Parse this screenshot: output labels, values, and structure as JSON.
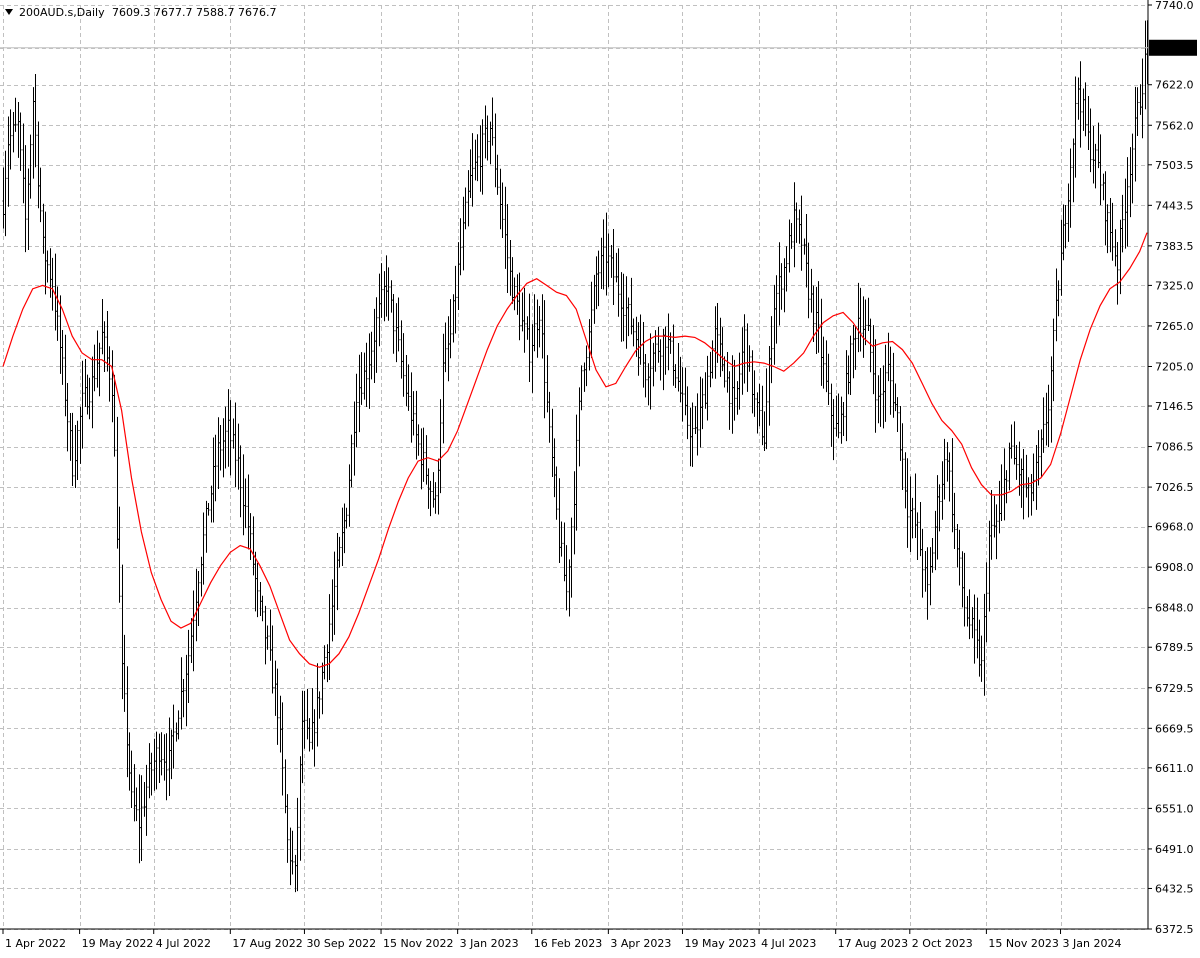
{
  "header": {
    "symbol": "200AUD.s,Daily",
    "ohlc": "7609.3 7677.7 7588.7 7676.7"
  },
  "colors": {
    "background": "#ffffff",
    "grid": "#c0c0c0",
    "bars": "#000000",
    "ma_line": "#ff0000",
    "price_badge_bg": "#000000",
    "price_badge_text": "#ffffff"
  },
  "chart_data": {
    "type": "ohlc-bar",
    "title": "200AUD.s,Daily",
    "grid": true,
    "ylim": [
      6372.5,
      7740.0
    ],
    "y_ticks": [
      "7740.0",
      "7676.7",
      "7622.0",
      "7562.0",
      "7503.5",
      "7443.5",
      "7383.5",
      "7325.0",
      "7265.0",
      "7205.0",
      "7146.5",
      "7086.5",
      "7026.5",
      "6968.0",
      "6908.0",
      "6848.0",
      "6789.5",
      "6729.5",
      "6669.5",
      "6611.0",
      "6551.0",
      "6491.0",
      "6432.5",
      "6372.5"
    ],
    "x_ticks": [
      "1 Apr 2022",
      "19 May 2022",
      "4 Jul 2022",
      "17 Aug 2022",
      "30 Sep 2022",
      "15 Nov 2022",
      "3 Jan 2023",
      "16 Feb 2023",
      "3 Apr 2023",
      "19 May 2023",
      "4 Jul 2023",
      "17 Aug 2023",
      "2 Oct 2023",
      "15 Nov 2023",
      "3 Jan 2024"
    ],
    "last_price": "7676.7",
    "close_path": [
      [
        0,
        7450
      ],
      [
        2,
        7540
      ],
      [
        6,
        7560
      ],
      [
        9,
        7420
      ],
      [
        12,
        7600
      ],
      [
        16,
        7380
      ],
      [
        20,
        7330
      ],
      [
        24,
        7200
      ],
      [
        28,
        7060
      ],
      [
        32,
        7150
      ],
      [
        36,
        7180
      ],
      [
        40,
        7250
      ],
      [
        44,
        7180
      ],
      [
        48,
        6750
      ],
      [
        52,
        6560
      ],
      [
        55,
        6530
      ],
      [
        59,
        6600
      ],
      [
        63,
        6640
      ],
      [
        67,
        6620
      ],
      [
        71,
        6700
      ],
      [
        75,
        6780
      ],
      [
        79,
        6900
      ],
      [
        83,
        7000
      ],
      [
        87,
        7080
      ],
      [
        91,
        7110
      ],
      [
        95,
        7060
      ],
      [
        99,
        6970
      ],
      [
        103,
        6860
      ],
      [
        107,
        6790
      ],
      [
        111,
        6700
      ],
      [
        115,
        6500
      ],
      [
        118,
        6450
      ],
      [
        121,
        6680
      ],
      [
        124,
        6640
      ],
      [
        127,
        6700
      ],
      [
        131,
        6800
      ],
      [
        135,
        6900
      ],
      [
        139,
        7000
      ],
      [
        143,
        7170
      ],
      [
        147,
        7200
      ],
      [
        151,
        7270
      ],
      [
        155,
        7330
      ],
      [
        159,
        7250
      ],
      [
        163,
        7170
      ],
      [
        167,
        7100
      ],
      [
        171,
        7050
      ],
      [
        175,
        7000
      ],
      [
        178,
        7200
      ],
      [
        181,
        7250
      ],
      [
        185,
        7380
      ],
      [
        189,
        7480
      ],
      [
        193,
        7520
      ],
      [
        197,
        7560
      ],
      [
        201,
        7450
      ],
      [
        205,
        7340
      ],
      [
        209,
        7280
      ],
      [
        213,
        7230
      ],
      [
        217,
        7290
      ],
      [
        221,
        7100
      ],
      [
        225,
        6950
      ],
      [
        228,
        6870
      ],
      [
        231,
        7020
      ],
      [
        234,
        7200
      ],
      [
        237,
        7250
      ],
      [
        240,
        7340
      ],
      [
        244,
        7370
      ],
      [
        248,
        7330
      ],
      [
        252,
        7290
      ],
      [
        256,
        7250
      ],
      [
        260,
        7200
      ],
      [
        264,
        7230
      ],
      [
        268,
        7250
      ],
      [
        272,
        7200
      ],
      [
        276,
        7130
      ],
      [
        280,
        7100
      ],
      [
        284,
        7170
      ],
      [
        288,
        7250
      ],
      [
        292,
        7200
      ],
      [
        296,
        7140
      ],
      [
        300,
        7250
      ],
      [
        304,
        7150
      ],
      [
        308,
        7100
      ],
      [
        312,
        7300
      ],
      [
        316,
        7350
      ],
      [
        320,
        7420
      ],
      [
        323,
        7390
      ],
      [
        326,
        7320
      ],
      [
        330,
        7250
      ],
      [
        334,
        7150
      ],
      [
        338,
        7100
      ],
      [
        342,
        7200
      ],
      [
        346,
        7280
      ],
      [
        350,
        7250
      ],
      [
        354,
        7150
      ],
      [
        358,
        7200
      ],
      [
        362,
        7130
      ],
      [
        366,
        7000
      ],
      [
        370,
        6960
      ],
      [
        374,
        6870
      ],
      [
        378,
        7000
      ],
      [
        382,
        7080
      ],
      [
        385,
        6960
      ],
      [
        389,
        6850
      ],
      [
        393,
        6800
      ],
      [
        396,
        6760
      ],
      [
        399,
        6950
      ],
      [
        403,
        6980
      ],
      [
        407,
        7080
      ],
      [
        411,
        7050
      ],
      [
        415,
        7010
      ],
      [
        419,
        7060
      ],
      [
        423,
        7150
      ],
      [
        427,
        7330
      ],
      [
        431,
        7470
      ],
      [
        435,
        7620
      ],
      [
        439,
        7540
      ],
      [
        443,
        7500
      ],
      [
        447,
        7420
      ],
      [
        451,
        7360
      ],
      [
        455,
        7480
      ],
      [
        459,
        7580
      ],
      [
        463,
        7676.7
      ]
    ],
    "moving_average": [
      [
        0,
        7205
      ],
      [
        4,
        7250
      ],
      [
        8,
        7290
      ],
      [
        12,
        7320
      ],
      [
        16,
        7325
      ],
      [
        20,
        7320
      ],
      [
        24,
        7290
      ],
      [
        28,
        7250
      ],
      [
        32,
        7225
      ],
      [
        36,
        7215
      ],
      [
        40,
        7215
      ],
      [
        44,
        7205
      ],
      [
        48,
        7140
      ],
      [
        52,
        7040
      ],
      [
        56,
        6960
      ],
      [
        60,
        6900
      ],
      [
        64,
        6860
      ],
      [
        68,
        6828
      ],
      [
        72,
        6818
      ],
      [
        76,
        6825
      ],
      [
        80,
        6855
      ],
      [
        84,
        6885
      ],
      [
        88,
        6910
      ],
      [
        92,
        6930
      ],
      [
        96,
        6940
      ],
      [
        100,
        6935
      ],
      [
        104,
        6910
      ],
      [
        108,
        6880
      ],
      [
        112,
        6840
      ],
      [
        116,
        6800
      ],
      [
        120,
        6780
      ],
      [
        124,
        6765
      ],
      [
        128,
        6760
      ],
      [
        132,
        6765
      ],
      [
        136,
        6780
      ],
      [
        140,
        6805
      ],
      [
        144,
        6840
      ],
      [
        148,
        6880
      ],
      [
        152,
        6920
      ],
      [
        156,
        6965
      ],
      [
        160,
        7005
      ],
      [
        164,
        7040
      ],
      [
        168,
        7065
      ],
      [
        172,
        7070
      ],
      [
        176,
        7065
      ],
      [
        180,
        7080
      ],
      [
        184,
        7110
      ],
      [
        188,
        7150
      ],
      [
        192,
        7190
      ],
      [
        196,
        7230
      ],
      [
        200,
        7265
      ],
      [
        204,
        7290
      ],
      [
        208,
        7310
      ],
      [
        212,
        7328
      ],
      [
        216,
        7335
      ],
      [
        220,
        7325
      ],
      [
        224,
        7315
      ],
      [
        228,
        7310
      ],
      [
        232,
        7290
      ],
      [
        236,
        7245
      ],
      [
        240,
        7200
      ],
      [
        244,
        7175
      ],
      [
        248,
        7180
      ],
      [
        252,
        7205
      ],
      [
        256,
        7228
      ],
      [
        260,
        7242
      ],
      [
        264,
        7250
      ],
      [
        268,
        7250
      ],
      [
        272,
        7248
      ],
      [
        276,
        7250
      ],
      [
        280,
        7248
      ],
      [
        284,
        7240
      ],
      [
        288,
        7228
      ],
      [
        292,
        7215
      ],
      [
        296,
        7205
      ],
      [
        300,
        7210
      ],
      [
        304,
        7212
      ],
      [
        308,
        7210
      ],
      [
        312,
        7205
      ],
      [
        316,
        7198
      ],
      [
        320,
        7210
      ],
      [
        324,
        7225
      ],
      [
        328,
        7250
      ],
      [
        332,
        7270
      ],
      [
        336,
        7280
      ],
      [
        340,
        7285
      ],
      [
        344,
        7270
      ],
      [
        348,
        7248
      ],
      [
        352,
        7235
      ],
      [
        356,
        7240
      ],
      [
        360,
        7242
      ],
      [
        364,
        7230
      ],
      [
        368,
        7210
      ],
      [
        372,
        7180
      ],
      [
        376,
        7150
      ],
      [
        380,
        7125
      ],
      [
        384,
        7110
      ],
      [
        388,
        7090
      ],
      [
        392,
        7055
      ],
      [
        396,
        7030
      ],
      [
        400,
        7015
      ],
      [
        404,
        7015
      ],
      [
        408,
        7020
      ],
      [
        412,
        7030
      ],
      [
        416,
        7032
      ],
      [
        420,
        7040
      ],
      [
        424,
        7060
      ],
      [
        428,
        7105
      ],
      [
        432,
        7160
      ],
      [
        436,
        7215
      ],
      [
        440,
        7260
      ],
      [
        444,
        7295
      ],
      [
        448,
        7320
      ],
      [
        452,
        7330
      ],
      [
        456,
        7350
      ],
      [
        460,
        7375
      ],
      [
        463,
        7403
      ]
    ]
  }
}
